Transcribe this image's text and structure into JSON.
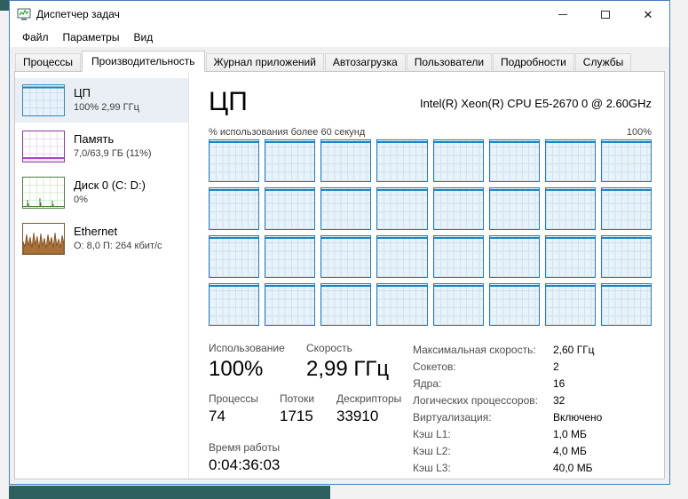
{
  "desktop": {
    "accent_color": "#2e6060"
  },
  "window": {
    "title": "Диспетчер задач"
  },
  "menu": {
    "items": [
      {
        "label": "Файл"
      },
      {
        "label": "Параметры"
      },
      {
        "label": "Вид"
      }
    ]
  },
  "tabs": [
    {
      "label": "Процессы",
      "active": false
    },
    {
      "label": "Производительность",
      "active": true
    },
    {
      "label": "Журнал приложений",
      "active": false
    },
    {
      "label": "Автозагрузка",
      "active": false
    },
    {
      "label": "Пользователи",
      "active": false
    },
    {
      "label": "Подробности",
      "active": false
    },
    {
      "label": "Службы",
      "active": false
    }
  ],
  "sidebar": {
    "items": [
      {
        "id": "cpu",
        "title": "ЦП",
        "subtitle": "100% 2,99 ГГц",
        "selected": true,
        "accent_color": "#117dbb"
      },
      {
        "id": "memory",
        "title": "Память",
        "subtitle": "7,0/63,9 ГБ (11%)",
        "selected": false,
        "accent_color": "#8b12ae"
      },
      {
        "id": "disk",
        "title": "Диск 0 (C: D:)",
        "subtitle": "0%",
        "selected": false,
        "accent_color": "#4c7a3c"
      },
      {
        "id": "ethernet",
        "title": "Ethernet",
        "subtitle": "О: 8,0 П: 264 кбит/с",
        "selected": false,
        "accent_color": "#8c5a28"
      }
    ]
  },
  "main": {
    "title": "ЦП",
    "cpu_name": "Intel(R) Xeon(R) CPU E5-2670 0 @ 2.60GHz",
    "graph_caption_left": "% использования более 60 секунд",
    "graph_caption_right": "100%",
    "core_count": 32,
    "grid_columns": 8,
    "stats": {
      "usage": {
        "label": "Использование",
        "value": "100%"
      },
      "speed": {
        "label": "Скорость",
        "value": "2,99 ГГц"
      },
      "processes": {
        "label": "Процессы",
        "value": "74"
      },
      "threads": {
        "label": "Потоки",
        "value": "1715"
      },
      "handles": {
        "label": "Дескрипторы",
        "value": "33910"
      },
      "uptime": {
        "label": "Время работы",
        "value": "0:04:36:03"
      }
    },
    "details": [
      {
        "label": "Максимальная скорость:",
        "value": "2,60 ГГц"
      },
      {
        "label": "Сокетов:",
        "value": "2"
      },
      {
        "label": "Ядра:",
        "value": "16"
      },
      {
        "label": "Логических процессоров:",
        "value": "32"
      },
      {
        "label": "Виртуализация:",
        "value": "Включено"
      },
      {
        "label": "Кэш L1:",
        "value": "1,0 МБ"
      },
      {
        "label": "Кэш L2:",
        "value": "4,0 МБ"
      },
      {
        "label": "Кэш L3:",
        "value": "40,0 МБ"
      }
    ]
  }
}
